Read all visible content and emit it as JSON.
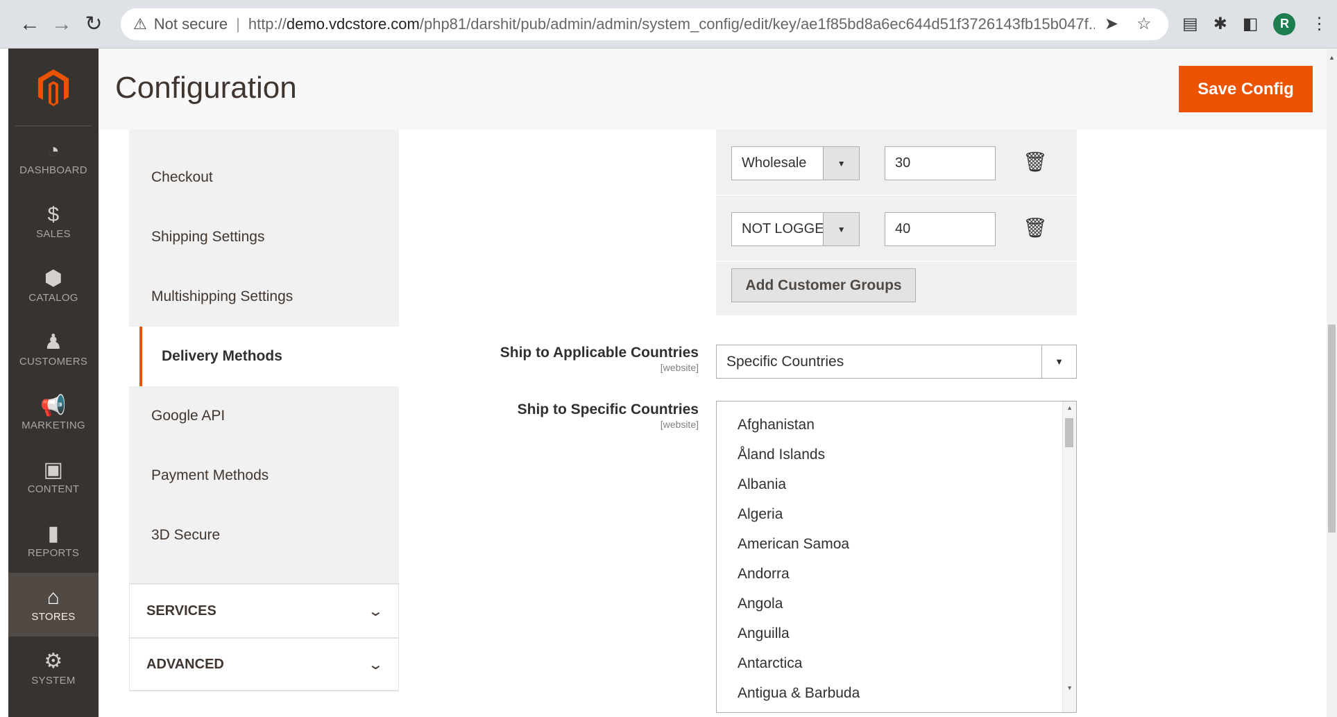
{
  "browser": {
    "security_label": "Not secure",
    "url_prefix": "http://",
    "url_host": "demo.vdcstore.com",
    "url_path": "/php81/darshit/pub/admin/admin/system_config/edit/key/ae1f85bd8a6ec644d51f3726143fb15b047f...",
    "profile_initial": "R"
  },
  "admin_menu": [
    {
      "label": "DASHBOARD",
      "icon": "dashboard-icon",
      "glyph": "◔"
    },
    {
      "label": "SALES",
      "icon": "dollar-icon",
      "glyph": "$"
    },
    {
      "label": "CATALOG",
      "icon": "box-icon",
      "glyph": "⬢"
    },
    {
      "label": "CUSTOMERS",
      "icon": "person-icon",
      "glyph": "♟"
    },
    {
      "label": "MARKETING",
      "icon": "megaphone-icon",
      "glyph": "📢"
    },
    {
      "label": "CONTENT",
      "icon": "layout-icon",
      "glyph": "▣"
    },
    {
      "label": "REPORTS",
      "icon": "bar-chart-icon",
      "glyph": "▮"
    },
    {
      "label": "STORES",
      "icon": "store-icon",
      "glyph": "⌂"
    },
    {
      "label": "SYSTEM",
      "icon": "gear-icon",
      "glyph": "⚙"
    }
  ],
  "header": {
    "title": "Configuration",
    "save_label": "Save Config"
  },
  "config_nav": {
    "items": [
      "Checkout",
      "Shipping Settings",
      "Multishipping Settings",
      "Delivery Methods",
      "Google API",
      "Payment Methods",
      "3D Secure"
    ],
    "active": "Delivery Methods",
    "sections": [
      "SERVICES",
      "ADVANCED"
    ]
  },
  "customer_groups": {
    "rows": [
      {
        "group": "Wholesale",
        "value": "30"
      },
      {
        "group": "NOT LOGGED IN",
        "value": "40"
      }
    ],
    "add_label": "Add Customer Groups"
  },
  "fields": {
    "applicable_label": "Ship to Applicable Countries",
    "applicable_scope": "[website]",
    "applicable_value": "Specific Countries",
    "specific_label": "Ship to Specific Countries",
    "specific_scope": "[website]",
    "countries": [
      "Afghanistan",
      "Åland Islands",
      "Albania",
      "Algeria",
      "American Samoa",
      "Andorra",
      "Angola",
      "Anguilla",
      "Antarctica",
      "Antigua & Barbuda"
    ]
  },
  "colors": {
    "accent": "#eb5202",
    "sidebar": "#373330",
    "sidebar_active": "#514943"
  }
}
